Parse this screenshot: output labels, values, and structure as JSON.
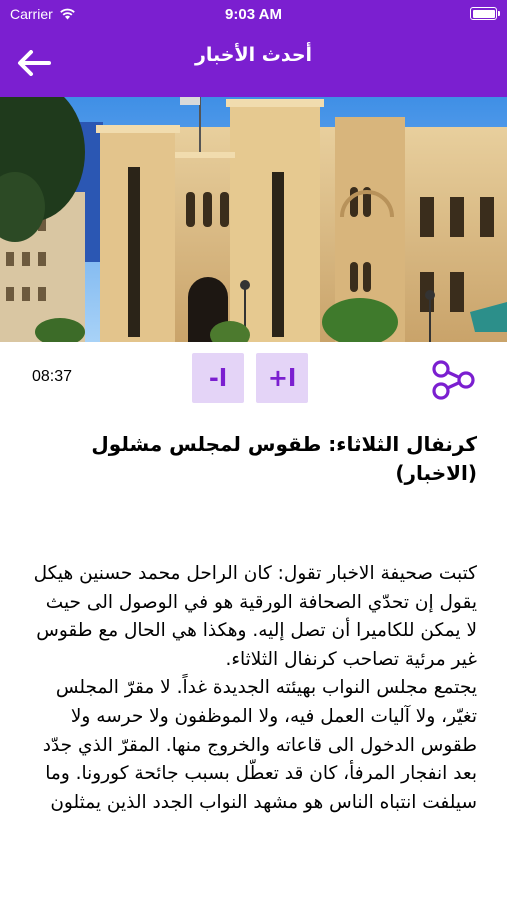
{
  "status_bar": {
    "carrier": "Carrier",
    "time": "9:03 AM"
  },
  "nav": {
    "title": "أحدث الأخبار",
    "back_icon": "arrow-left-icon"
  },
  "toolbar": {
    "time": "08:37",
    "font_decrease_label": "-ا",
    "font_increase_label": "+ا",
    "share_icon": "share-nodes-icon"
  },
  "article": {
    "title": "كرنفال الثلاثاء: طقوس لمجلس مشلول (الاخبار)",
    "body": "كتبت صحيفة الاخبار تقول: كان الراحل محمد حسنين هيكل يقول إن تحدّي الصحافة الورقية هو في الوصول الى حيث لا يمكن للكاميرا أن تصل إليه. وهكذا هي الحال مع طقوس غير مرئية تصاحب كرنفال الثلاثاء.\nيجتمع مجلس النواب بهيئته الجديدة غداً. لا مقرّ المجلس تغيّر، ولا آليات العمل فيه، ولا الموظفون ولا حرسه ولا طقوس الدخول الى قاعاته والخروج منها. المقرّ الذي جدّد بعد انفجار المرفأ، كان قد تعطّل بسبب جائحة كورونا. وما سيلفت انتباه الناس هو مشهد النواب الجدد الذين يمثلون"
  },
  "colors": {
    "accent": "#7b1fd0",
    "button_bg": "#e4d4f7"
  }
}
